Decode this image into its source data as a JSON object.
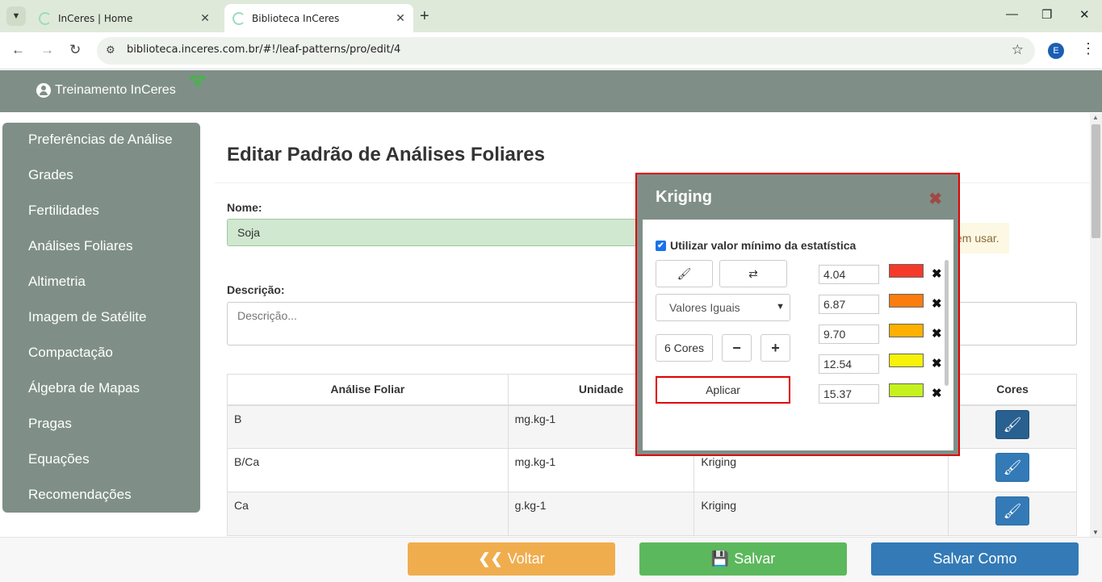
{
  "browser": {
    "tabs": [
      {
        "title": "InCeres | Home",
        "active": false
      },
      {
        "title": "Biblioteca InCeres",
        "active": true
      }
    ],
    "url": "biblioteca.inceres.com.br/#!/leaf-patterns/pro/edit/4",
    "profile_initial": "E"
  },
  "header": {
    "user_name": "Treinamento InCeres"
  },
  "sidebar": {
    "items": [
      {
        "label": "Preferências de Análise"
      },
      {
        "label": "Grades"
      },
      {
        "label": "Fertilidades"
      },
      {
        "label": "Análises Foliares"
      },
      {
        "label": "Altimetria"
      },
      {
        "label": "Imagem de Satélite"
      },
      {
        "label": "Compactação"
      },
      {
        "label": "Álgebra de Mapas"
      },
      {
        "label": "Pragas"
      },
      {
        "label": "Equações"
      },
      {
        "label": "Recomendações"
      }
    ]
  },
  "main": {
    "title": "Editar Padrão de Análises Foliares",
    "name_label": "Nome:",
    "name_value": "Soja",
    "hint_text": "em usar.",
    "desc_label": "Descrição:",
    "desc_placeholder": "Descrição...",
    "table": {
      "headers": [
        "Análise Foliar",
        "Unidade",
        "",
        "Cores"
      ],
      "rows": [
        {
          "analysis": "B",
          "unit": "mg.kg-1",
          "method": ""
        },
        {
          "analysis": "B/Ca",
          "unit": "mg.kg-1",
          "method": "Kriging"
        },
        {
          "analysis": "Ca",
          "unit": "g.kg-1",
          "method": "Kriging"
        }
      ]
    }
  },
  "modal": {
    "title": "Kriging",
    "checkbox_label": "Utilizar valor mínimo da estatística",
    "checkbox_checked": true,
    "select_value": "Valores Iguais",
    "colors_count_label": "6 Cores",
    "minus_label": "−",
    "plus_label": "+",
    "apply_label": "Aplicar",
    "breaks": [
      {
        "value": "4.04",
        "color": "#f53a2a"
      },
      {
        "value": "6.87",
        "color": "#fb7d10"
      },
      {
        "value": "9.70",
        "color": "#ffb000"
      },
      {
        "value": "12.54",
        "color": "#f6f20a"
      },
      {
        "value": "15.37",
        "color": "#c5f21e"
      }
    ]
  },
  "footer": {
    "back_label": "Voltar",
    "save_label": "Salvar",
    "save_as_label": "Salvar Como",
    "colors": {
      "back": "#f0ad4e",
      "save": "#5cb85c",
      "save_as": "#337ab7"
    }
  }
}
